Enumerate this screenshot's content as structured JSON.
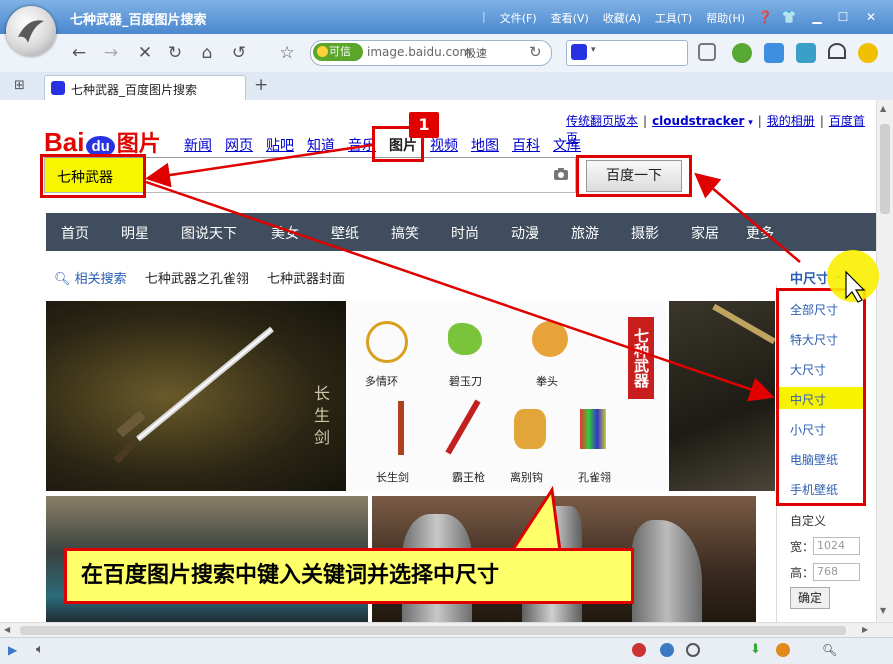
{
  "window": {
    "title": "七种武器_百度图片搜索",
    "menu": [
      "文件(F)",
      "查看(V)",
      "收藏(A)",
      "工具(T)",
      "帮助(H)"
    ]
  },
  "navbar": {
    "trust_label": "可信",
    "url": "image.baidu.com",
    "speed_label": "极速"
  },
  "tabs": [
    {
      "label": "七种武器_百度图片搜索"
    }
  ],
  "page": {
    "top_links": [
      "传统翻页版本",
      "cloudstracker",
      "我的相册",
      "百度首页"
    ],
    "logo": {
      "bai": "Bai",
      "du": "du",
      "pic": "图片"
    },
    "channels": [
      "新闻",
      "网页",
      "贴吧",
      "知道",
      "音乐",
      "图片",
      "视频",
      "地图",
      "百科",
      "文库"
    ],
    "search": {
      "query": "七种武器",
      "button_label": "百度一下"
    },
    "categories": [
      "首页",
      "明星",
      "图说天下",
      "美女",
      "壁纸",
      "搞笑",
      "时尚",
      "动漫",
      "旅游",
      "摄影",
      "家居",
      "更多"
    ],
    "related": {
      "label": "相关搜索",
      "keywords": [
        "七种武器之孔雀翎",
        "七种武器封面"
      ]
    },
    "size_filter": {
      "current": "中尺寸",
      "options": [
        "全部尺寸",
        "特大尺寸",
        "大尺寸",
        "中尺寸",
        "小尺寸",
        "电脑壁纸",
        "手机壁纸"
      ],
      "selected_index": 3,
      "custom_label": "自定义",
      "width_label": "宽：",
      "width_placeholder": "1024",
      "height_label": "高：",
      "height_placeholder": "768",
      "confirm_label": "确定"
    },
    "images": {
      "sword": {
        "caption": "长生剑"
      },
      "weapons": {
        "labels": [
          "多情环",
          "碧玉刀",
          "拳头",
          "长生剑",
          "霸王枪",
          "离别钩",
          "孔雀翎"
        ],
        "banner": "七种武器"
      }
    }
  },
  "annotation": {
    "step_number": "1",
    "callout_text": "在百度图片搜索中键入关键词并选择中尺寸"
  },
  "colors": {
    "annotation_red": "#e00000",
    "highlight_yellow": "#f7f300",
    "catbar_bg": "#3f4d5e",
    "link_blue": "#0000cc"
  }
}
